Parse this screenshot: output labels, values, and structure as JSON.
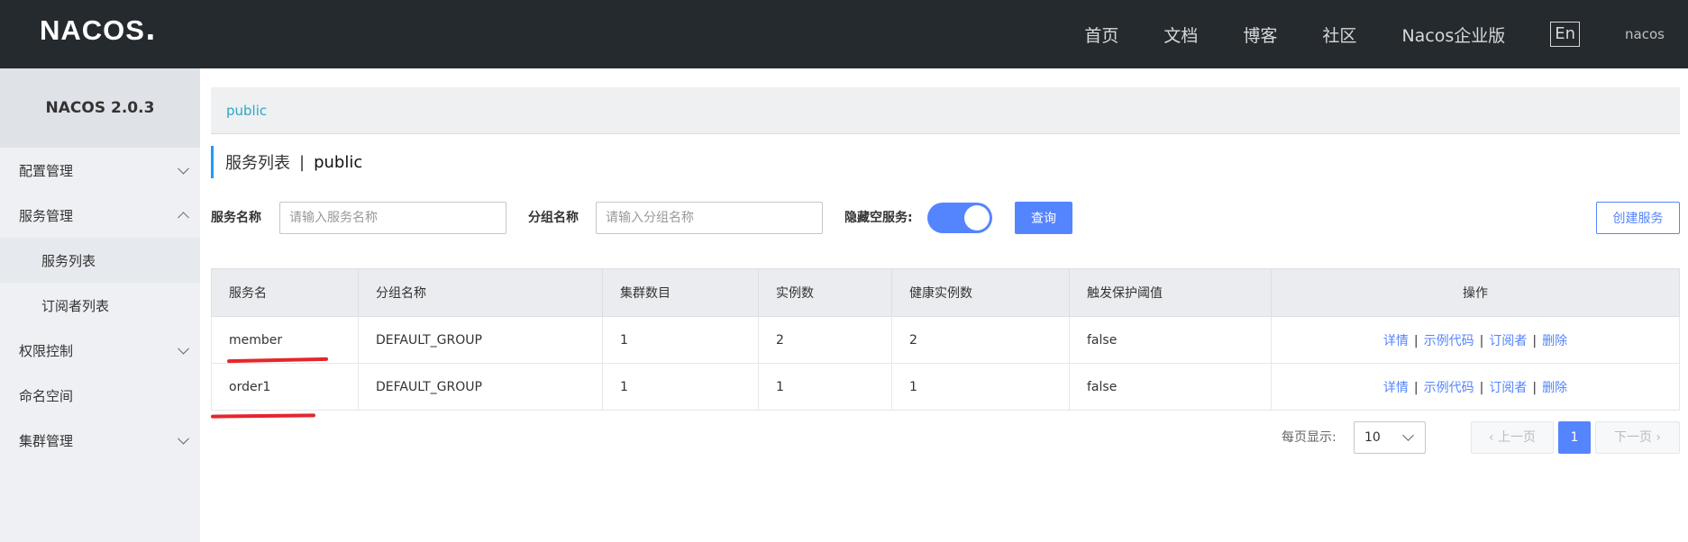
{
  "header": {
    "logo": "NACOS",
    "logo_suffix": ".",
    "nav": [
      "首页",
      "文档",
      "博客",
      "社区",
      "Nacos企业版"
    ],
    "lang": "En",
    "user": "nacos"
  },
  "sidebar": {
    "version": "NACOS 2.0.3",
    "items": [
      {
        "label": "配置管理"
      },
      {
        "label": "服务管理"
      },
      {
        "label": "服务列表"
      },
      {
        "label": "订阅者列表"
      },
      {
        "label": "权限控制"
      },
      {
        "label": "命名空间"
      },
      {
        "label": "集群管理"
      }
    ]
  },
  "breadcrumb": "public",
  "title": {
    "main": "服务列表",
    "sep": "|",
    "namespace": "public"
  },
  "filters": {
    "service_label": "服务名称",
    "service_placeholder": "请输入服务名称",
    "group_label": "分组名称",
    "group_placeholder": "请输入分组名称",
    "hide_empty_label": "隐藏空服务:",
    "hide_empty": true,
    "query_button": "查询",
    "create_button": "创建服务"
  },
  "table": {
    "columns": [
      "服务名",
      "分组名称",
      "集群数目",
      "实例数",
      "健康实例数",
      "触发保护阈值",
      "操作"
    ],
    "rows": [
      {
        "name": "member",
        "group": "DEFAULT_GROUP",
        "clusters": "1",
        "instances": "2",
        "healthy": "2",
        "threshold": "false"
      },
      {
        "name": "order1",
        "group": "DEFAULT_GROUP",
        "clusters": "1",
        "instances": "1",
        "healthy": "1",
        "threshold": "false"
      }
    ],
    "ops": [
      "详情",
      "示例代码",
      "订阅者",
      "删除"
    ],
    "op_sep": "|"
  },
  "pagination": {
    "label": "每页显示:",
    "page_size": "10",
    "prev": "上一页",
    "current": "1",
    "next": "下一页"
  },
  "colors": {
    "accent": "#5584ff",
    "topbar": "#252a2f",
    "annotation": "#e5262b"
  }
}
